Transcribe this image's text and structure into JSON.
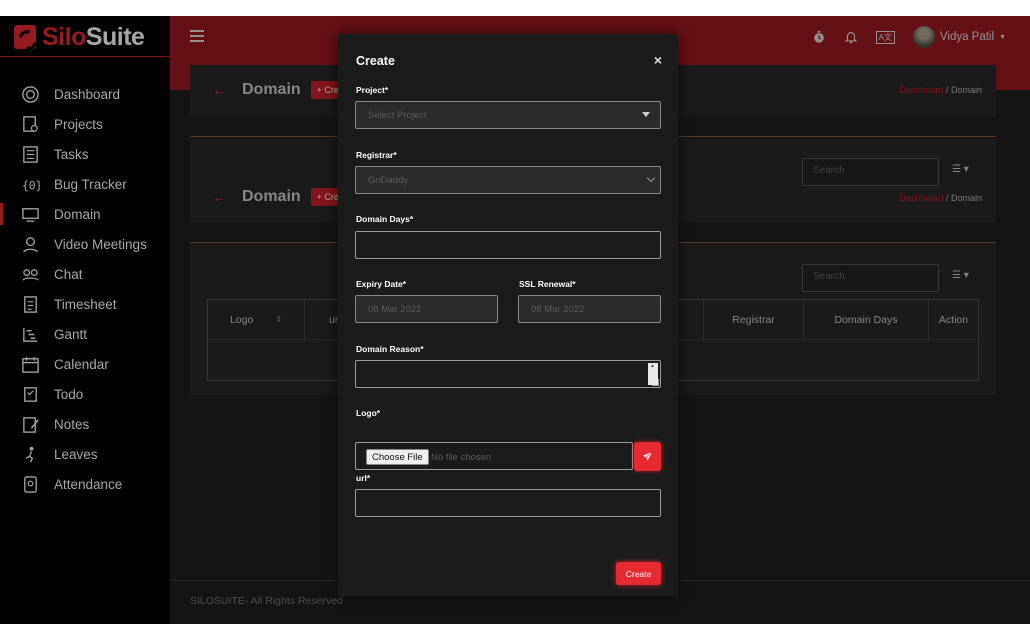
{
  "brand": {
    "part1": "Silo",
    "part2": "Suite"
  },
  "sidebar": {
    "items": [
      {
        "label": "Dashboard",
        "icon": "dashboard-icon"
      },
      {
        "label": "Projects",
        "icon": "projects-icon"
      },
      {
        "label": "Tasks",
        "icon": "tasks-icon"
      },
      {
        "label": "Bug Tracker",
        "icon": "bug-tracker-icon"
      },
      {
        "label": "Domain",
        "icon": "domain-icon",
        "active": true
      },
      {
        "label": "Video Meetings",
        "icon": "video-meetings-icon"
      },
      {
        "label": "Chat",
        "icon": "chat-icon"
      },
      {
        "label": "Timesheet",
        "icon": "timesheet-icon"
      },
      {
        "label": "Gantt",
        "icon": "gantt-icon"
      },
      {
        "label": "Calendar",
        "icon": "calendar-icon"
      },
      {
        "label": "Todo",
        "icon": "todo-icon"
      },
      {
        "label": "Notes",
        "icon": "notes-icon"
      },
      {
        "label": "Leaves",
        "icon": "leaves-icon"
      },
      {
        "label": "Attendance",
        "icon": "attendance-icon"
      }
    ]
  },
  "topbar": {
    "user_name": "Vidya Patil",
    "lang_badge": "A文"
  },
  "page": {
    "title": "Domain",
    "create_label": "+ Creat",
    "breadcrumb_root": "Dashboard",
    "breadcrumb_sep": "/",
    "breadcrumb_current": "Domain",
    "search_placeholder": "Search"
  },
  "table": {
    "headers": [
      "Logo",
      "ur",
      "Registrar",
      "Domain Days",
      "Action"
    ]
  },
  "footer": {
    "text": "SILOSUITE- All Rights Reserved"
  },
  "modal": {
    "title": "Create",
    "close": "×",
    "project": {
      "label": "Project*",
      "placeholder": "Select Project"
    },
    "registrar": {
      "label": "Registrar*",
      "value": "GoDaddy"
    },
    "domain_days": {
      "label": "Domain Days*",
      "value": ""
    },
    "expiry_date": {
      "label": "Expiry Date*",
      "value": "08 Mar 2022"
    },
    "ssl_renewal": {
      "label": "SSL Renewal*",
      "value": "08 Mar 2022"
    },
    "domain_reason": {
      "label": "Domain Reason*",
      "value": ""
    },
    "logo": {
      "label": "Logo*",
      "button": "Choose File",
      "status": "No file chosen"
    },
    "url": {
      "label": "url*",
      "value": ""
    },
    "submit_label": "Create"
  },
  "colors": {
    "accent": "#e62a2f",
    "topbar": "#9b1a1f",
    "sidebar": "#000000",
    "background": "#1f1f1f"
  }
}
